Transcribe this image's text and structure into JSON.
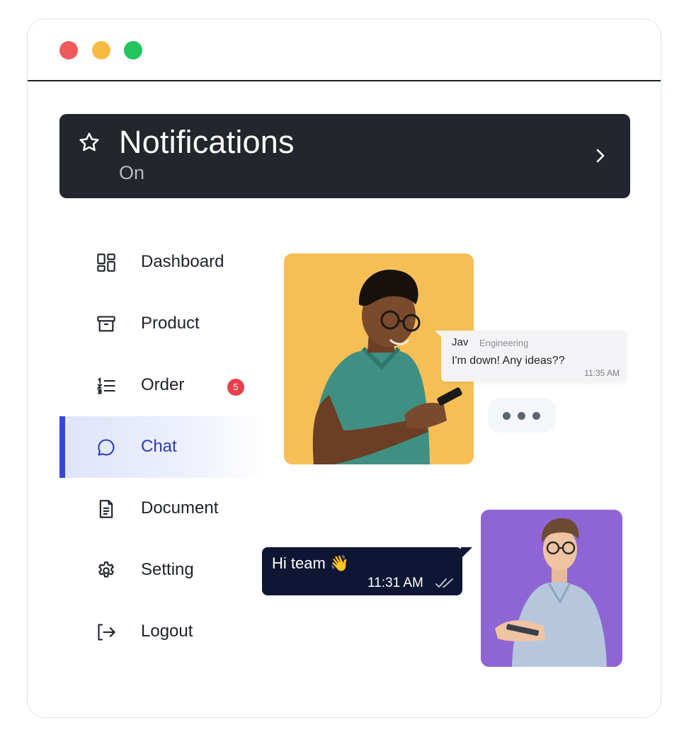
{
  "window": {
    "controls": [
      {
        "name": "close",
        "color": "#ef5b5b"
      },
      {
        "name": "minimize",
        "color": "#f6bb42"
      },
      {
        "name": "maximize",
        "color": "#22c55e"
      }
    ]
  },
  "notification_bar": {
    "icon": "star-icon",
    "title": "Notifications",
    "state": "On",
    "action_icon": "chevron-right-icon"
  },
  "sidebar": {
    "items": [
      {
        "label": "Dashboard",
        "icon": "grid-icon"
      },
      {
        "label": "Product",
        "icon": "archive-box-icon"
      },
      {
        "label": "Order",
        "icon": "list-ordered-icon",
        "badge": "5"
      },
      {
        "label": "Chat",
        "icon": "chat-bubble-icon",
        "active": true
      },
      {
        "label": "Document",
        "icon": "document-icon"
      },
      {
        "label": "Setting",
        "icon": "gear-icon"
      },
      {
        "label": "Logout",
        "icon": "logout-icon"
      }
    ],
    "accent_color": "#3448d8",
    "badge_color": "#e8404b"
  },
  "chat": {
    "incoming": {
      "sender": "Jav",
      "team": "Engineering",
      "text": "I'm down! Any ideas??",
      "time": "11:35 AM"
    },
    "outgoing": {
      "text": "Hi team 👋",
      "time": "11:31 AM",
      "status_icon": "double-check-icon"
    },
    "typing_indicator": "typing-dots"
  },
  "colors": {
    "header_bg": "#23262d",
    "photo1_bg": "#f6bf55",
    "photo2_bg": "#8e66d4",
    "outgoing_bubble": "#0f1634"
  }
}
